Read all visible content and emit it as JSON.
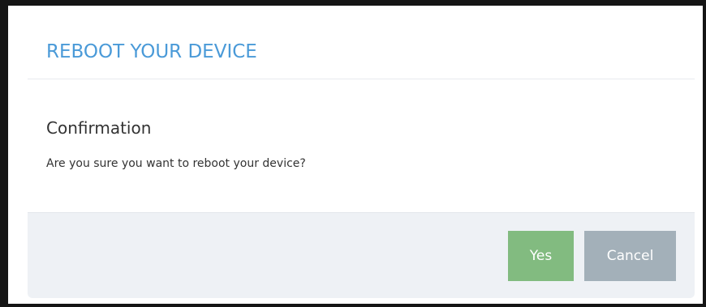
{
  "dialog": {
    "title": "REBOOT YOUR DEVICE",
    "heading": "Confirmation",
    "message": "Are you sure you want to reboot your device?",
    "buttons": {
      "yes_label": "Yes",
      "cancel_label": "Cancel"
    }
  },
  "colors": {
    "title": "#4a9ad8",
    "yes_button": "#82bb80",
    "cancel_button": "#a3b0b9",
    "footer_background": "#eef1f5",
    "frame": "#151515"
  }
}
